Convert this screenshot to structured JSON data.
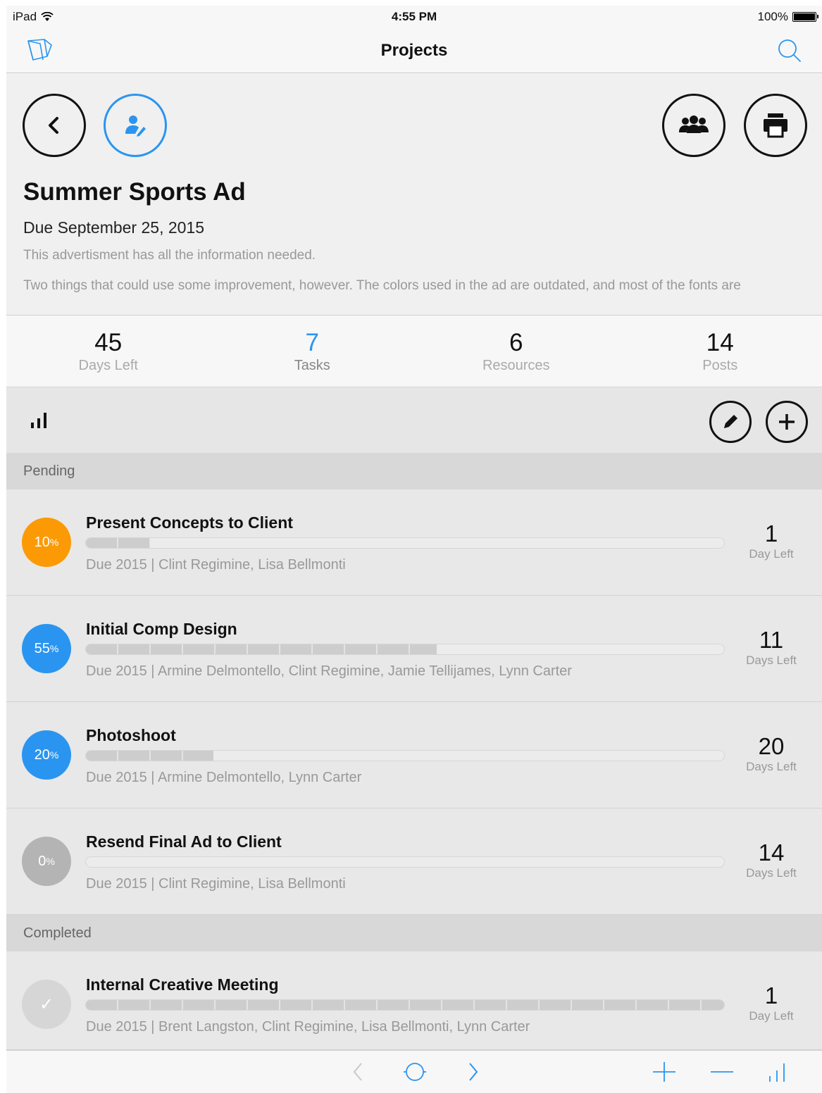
{
  "status_bar": {
    "device": "iPad",
    "time": "4:55 PM",
    "battery": "100%"
  },
  "navbar": {
    "title": "Projects"
  },
  "project": {
    "title": "Summer Sports Ad",
    "due": "Due September 25, 2015",
    "description": "This advertisment has all the information needed.",
    "description_more": "Two things that could use some improvement, however. The colors used in the ad are outdated, and most of the fonts are"
  },
  "stats": [
    {
      "value": "45",
      "label": "Days Left"
    },
    {
      "value": "7",
      "label": "Tasks"
    },
    {
      "value": "6",
      "label": "Resources"
    },
    {
      "value": "14",
      "label": "Posts"
    }
  ],
  "sections": {
    "pending": "Pending",
    "completed": "Completed"
  },
  "tasks": [
    {
      "percent": "10",
      "percent_sign": "%",
      "progress": 0.1,
      "color": "#fb9a05",
      "name": "Present Concepts to Client",
      "meta": "Due 2015 | Clint Regimine, Lisa Bellmonti",
      "days": "1",
      "days_label": "Day Left"
    },
    {
      "percent": "55",
      "percent_sign": "%",
      "progress": 0.55,
      "color": "#2a95f0",
      "name": "Initial Comp Design",
      "meta": "Due 2015 | Armine Delmontello, Clint Regimine, Jamie Tellijames, Lynn Carter",
      "days": "11",
      "days_label": "Days Left"
    },
    {
      "percent": "20",
      "percent_sign": "%",
      "progress": 0.2,
      "color": "#2a95f0",
      "name": "Photoshoot",
      "meta": "Due 2015 | Armine Delmontello, Lynn Carter",
      "days": "20",
      "days_label": "Days Left"
    },
    {
      "percent": "0",
      "percent_sign": "%",
      "progress": 0.0,
      "color": "#b4b4b4",
      "name": "Resend Final Ad to Client",
      "meta": "Due 2015 | Clint Regimine, Lisa Bellmonti",
      "days": "14",
      "days_label": "Days Left"
    }
  ],
  "completed_tasks": [
    {
      "percent": "✓",
      "progress": 1.0,
      "color": "#d6d6d6",
      "name": "Internal Creative Meeting",
      "meta": "Due 2015 | Brent Langston, Clint Regimine, Lisa Bellmonti, Lynn Carter",
      "days": "1",
      "days_label": "Day Left"
    }
  ],
  "icons": {
    "folders": "folders-icon",
    "search": "search-icon",
    "back": "back-arrow-icon",
    "edit_person": "edit-person-icon",
    "group": "group-icon",
    "print": "print-icon",
    "chart": "bar-chart-icon",
    "pencil": "pencil-icon",
    "add": "plus-icon",
    "prev": "chevron-left-icon",
    "home": "circle-icon",
    "next": "chevron-right-icon",
    "zoom_in": "plus-icon",
    "zoom_out": "minus-icon",
    "stats": "bar-chart-icon"
  },
  "colors": {
    "accent": "#2a95f0",
    "orange": "#fb9a05",
    "grey": "#b4b4b4"
  }
}
